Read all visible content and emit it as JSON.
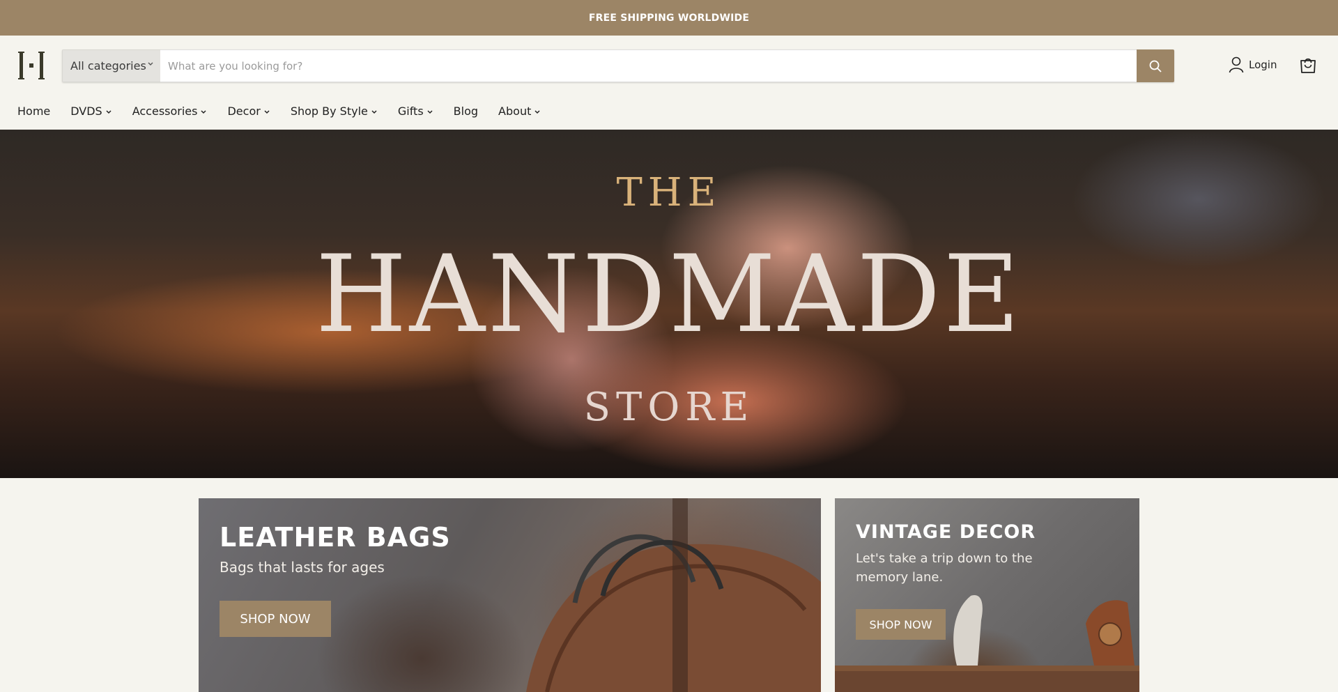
{
  "announcement": "FREE SHIPPING WORLDWIDE",
  "logo_letter": "H",
  "search": {
    "category": "All categories",
    "placeholder": "What are you looking for?"
  },
  "account": {
    "login_label": "Login"
  },
  "nav": [
    {
      "label": "Home",
      "dropdown": false
    },
    {
      "label": "DVDS",
      "dropdown": true
    },
    {
      "label": "Accessories",
      "dropdown": true
    },
    {
      "label": "Decor",
      "dropdown": true
    },
    {
      "label": "Shop By Style",
      "dropdown": true
    },
    {
      "label": "Gifts",
      "dropdown": true
    },
    {
      "label": "Blog",
      "dropdown": false
    },
    {
      "label": "About",
      "dropdown": true
    }
  ],
  "hero": {
    "line1": "THE",
    "line2": "HANDMADE",
    "line3": "STORE"
  },
  "promos": [
    {
      "title": "LEATHER BAGS",
      "subtitle": "Bags that lasts for ages",
      "button": "SHOP NOW"
    },
    {
      "title": "VINTAGE DECOR",
      "subtitle": "Let's take a trip down to the memory lane.",
      "button": "SHOP NOW"
    }
  ],
  "colors": {
    "accent": "#9c8566",
    "background": "#f5f4ee"
  }
}
